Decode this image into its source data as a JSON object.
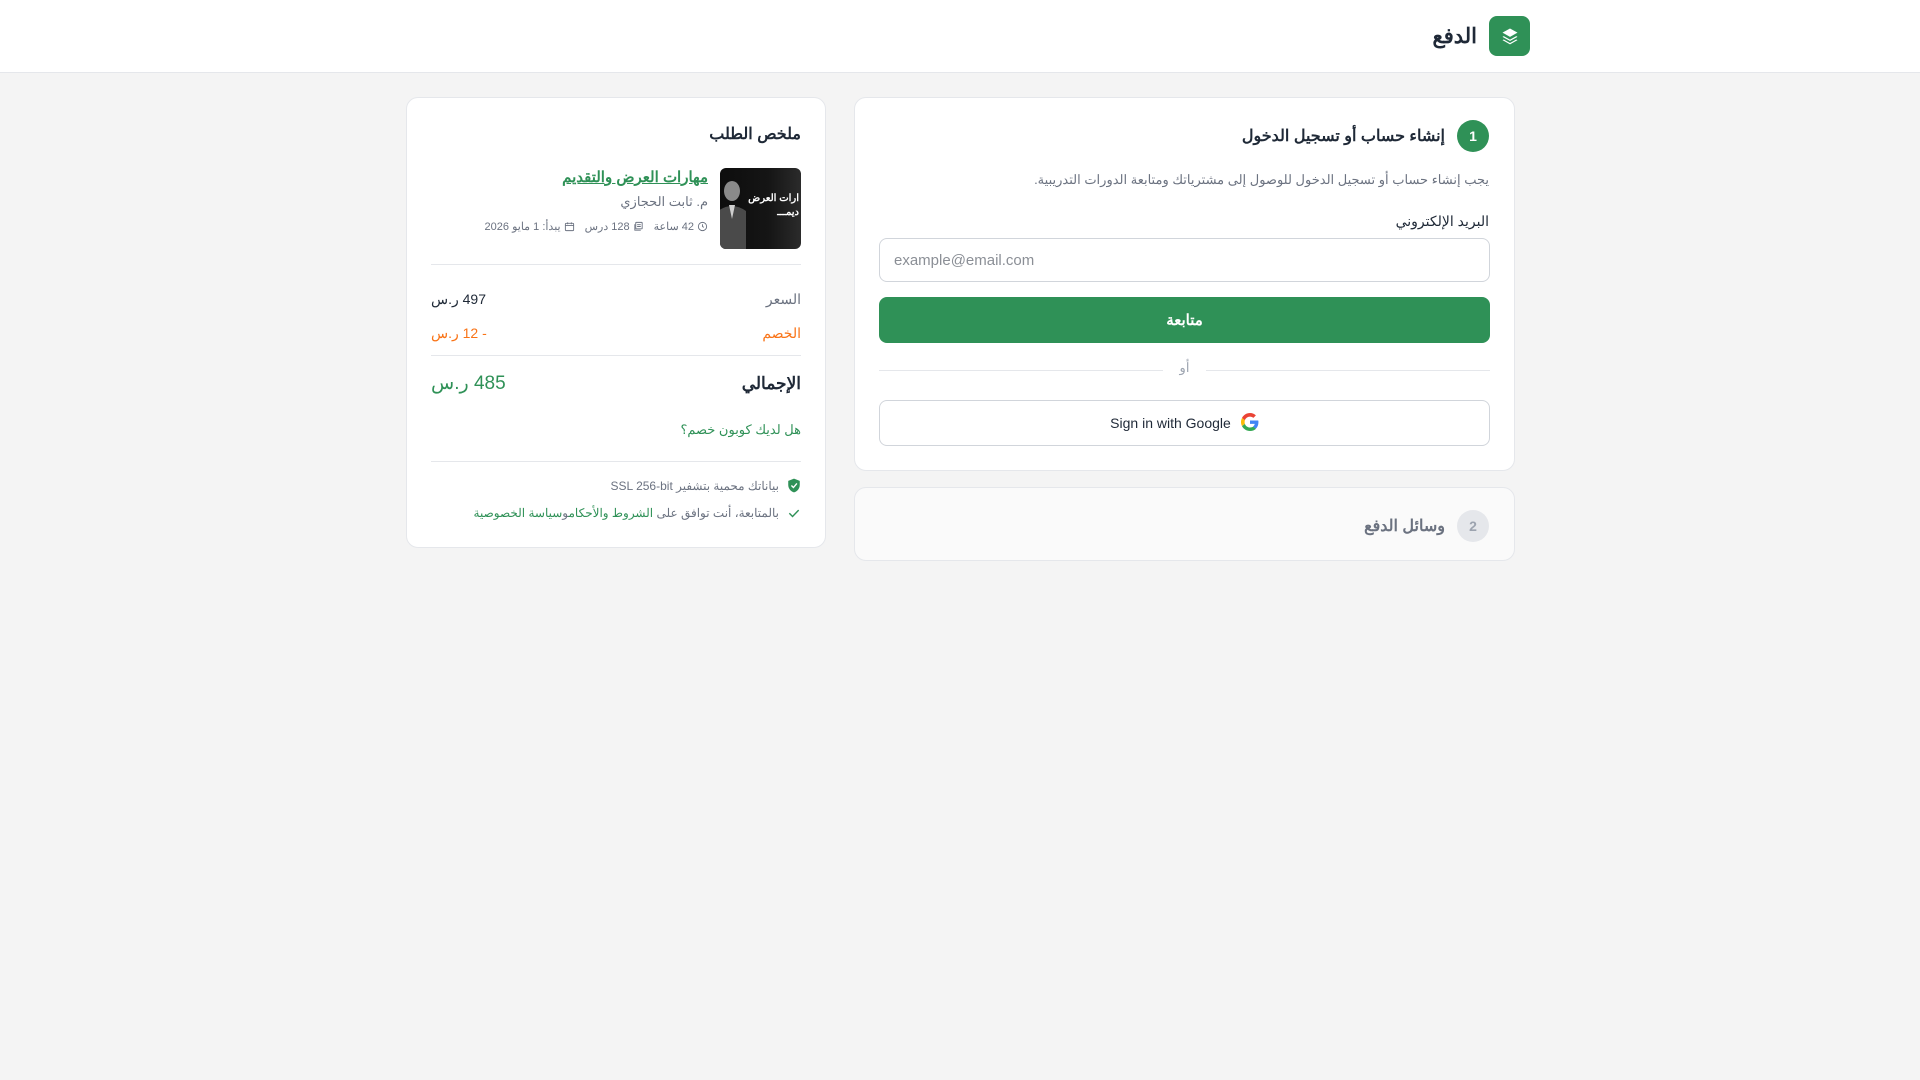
{
  "header": {
    "title": "الدفع"
  },
  "login_step": {
    "number": "1",
    "title": "إنشاء حساب أو تسجيل الدخول",
    "description": "يجب إنشاء حساب أو تسجيل الدخول للوصول إلى مشترياتك ومتابعة الدورات التدريبية.",
    "email_label": "البريد الإلكتروني",
    "email_value": "",
    "email_placeholder": "example@email.com",
    "continue_label": "متابعة",
    "or_label": "أو",
    "google_label": "Sign in with Google"
  },
  "payment_step": {
    "number": "2",
    "title": "وسائل الدفع"
  },
  "summary": {
    "title": "ملخص الطلب",
    "course": {
      "name": "مهارات العرض والتقديم",
      "author": "م. ثابت الحجازي",
      "thumb_line1": "ارات العرض",
      "thumb_line2": "ديمـــ",
      "duration": "42 ساعة",
      "lessons": "128 درس",
      "start": "يبدأ: 1 مايو 2026"
    },
    "price_label": "السعر",
    "price_value": "497 ر.س",
    "discount_label": "الخصم",
    "discount_value": "- 12 ر.س",
    "total_label": "الإجمالي",
    "total_value": "485 ر.س",
    "coupon_link": "هل لديك كوبون خصم؟",
    "secure_text": "بياناتك محمية بتشفير SSL 256-bit",
    "terms_prefix": "بالمتابعة، أنت توافق على",
    "terms_link": "الشروط والأحكام",
    "terms_and": "و",
    "privacy_link": "سياسة الخصوصية"
  },
  "colors": {
    "accent": "#2f9157",
    "discount": "#f97316",
    "background": "#f4f4f4"
  },
  "icons": [
    "stack-logo-icon",
    "google-icon",
    "clock-icon",
    "lessons-icon",
    "calendar-icon",
    "shield-check-icon",
    "check-icon"
  ]
}
